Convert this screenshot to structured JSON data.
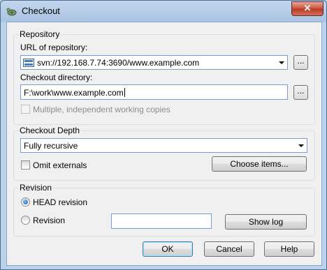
{
  "window": {
    "title": "Checkout",
    "close_label": "✕"
  },
  "repository": {
    "group_label": "Repository",
    "url_label": "URL of repository:",
    "url_value": "svn://192.168.7.74:3690/www.example.com",
    "checkout_dir_label": "Checkout directory:",
    "checkout_dir_value": "F:\\work\\www.example.com",
    "browse_label": "...",
    "multiple_copies_label": "Multiple, independent working copies"
  },
  "depth": {
    "group_label": "Checkout Depth",
    "selected": "Fully recursive",
    "omit_externals_label": "Omit externals",
    "choose_items_label": "Choose items..."
  },
  "revision": {
    "group_label": "Revision",
    "head_label": "HEAD revision",
    "revision_label": "Revision",
    "revision_value": "",
    "show_log_label": "Show log",
    "selected": "HEAD revision"
  },
  "buttons": {
    "ok": "OK",
    "cancel": "Cancel",
    "help": "Help"
  }
}
